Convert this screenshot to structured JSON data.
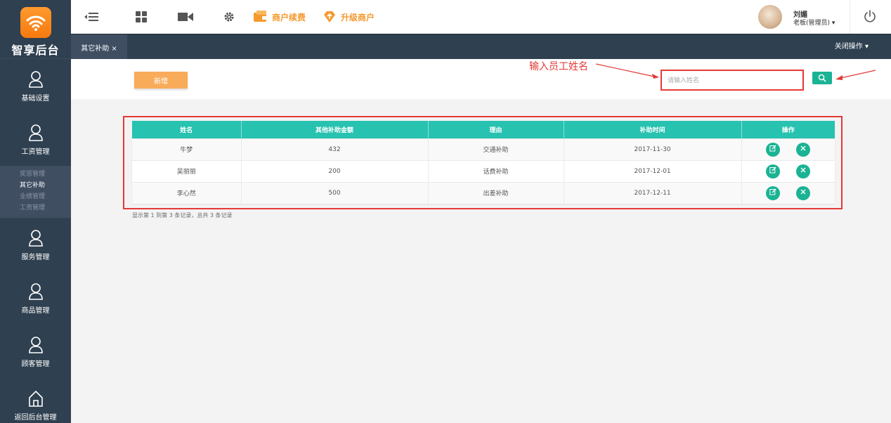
{
  "brand": {
    "name": "智享后台"
  },
  "sidebar": {
    "items": [
      {
        "label": "基础设置",
        "icon": "user-icon"
      },
      {
        "label": "工资管理",
        "icon": "user-icon"
      },
      {
        "label": "服务管理",
        "icon": "user-icon"
      },
      {
        "label": "商品管理",
        "icon": "user-icon"
      },
      {
        "label": "顾客管理",
        "icon": "user-icon"
      },
      {
        "label": "返回后台管理",
        "icon": "home-icon"
      }
    ],
    "submenu": [
      "奖惩管理",
      "其它补助",
      "业绩管理",
      "工资管理"
    ],
    "submenu_active": "其它补助"
  },
  "topbar": {
    "renew_label": "商户续费",
    "upgrade_label": "升级商户",
    "user_name": "刘媚",
    "user_role": "老板(管理员) ▾"
  },
  "tabs": {
    "active_tab": "其它补助 ×",
    "close_ops": "关闭操作 ▾"
  },
  "toolbar": {
    "add_label": "新增",
    "annotation": "输入员工姓名",
    "search_placeholder": "请输入姓名"
  },
  "table": {
    "columns": [
      "姓名",
      "其他补助金额",
      "理由",
      "补助时间",
      "操作"
    ],
    "rows": [
      {
        "name": "牛梦",
        "amount": "432",
        "reason": "交通补助",
        "date": "2017-11-30"
      },
      {
        "name": "吴丽丽",
        "amount": "200",
        "reason": "话费补助",
        "date": "2017-12-01"
      },
      {
        "name": "李心然",
        "amount": "500",
        "reason": "出差补助",
        "date": "2017-12-11"
      }
    ]
  },
  "pager": {
    "summary": "显示第 1 到第 3 条记录，总共 3 条记录"
  },
  "colors": {
    "sidebar": "#2f4050",
    "accent": "#1ab394",
    "header": "#27c2b0",
    "orange": "#f8ac59",
    "annotation_red": "#e53935"
  }
}
